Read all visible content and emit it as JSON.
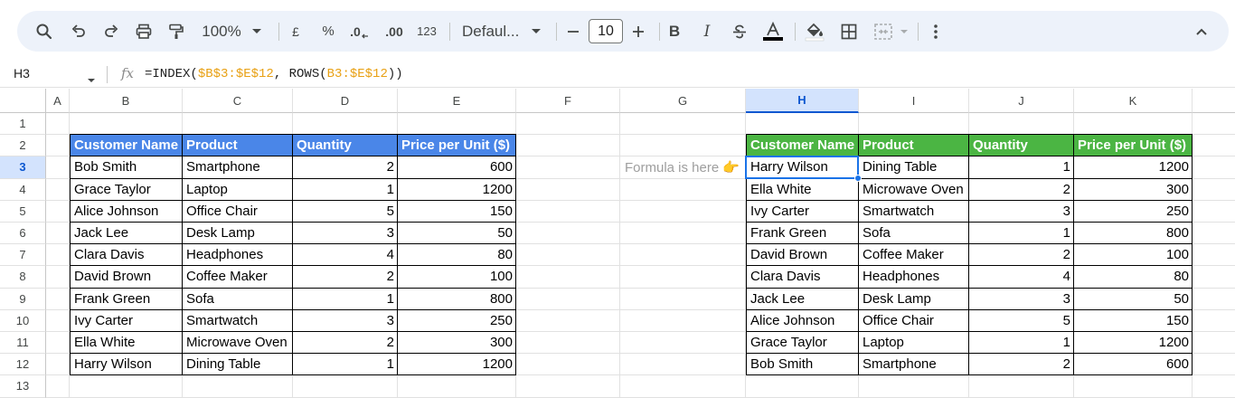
{
  "toolbar": {
    "zoom": "100%",
    "currency": "£",
    "percent": "%",
    "decrease_decimal": ".0",
    "increase_decimal": ".00",
    "number_format": "123",
    "font": "Defaul...",
    "font_size": "10",
    "bold": "B",
    "italic": "I",
    "icons": [
      "search-icon",
      "undo-icon",
      "redo-icon",
      "print-icon",
      "paint-format-icon",
      "zoom-dropdown-icon",
      "font-dropdown-icon",
      "minus-icon",
      "plus-icon",
      "strikethrough-icon",
      "text-color-icon",
      "fill-color-icon",
      "borders-icon",
      "merge-cells-icon",
      "more-options-icon",
      "collapse-icon"
    ],
    "text_color": "#000000",
    "accent": "#0b57d0"
  },
  "formula_bar": {
    "name_box": "H3",
    "fx": "fx",
    "formula_prefix": "=INDEX(",
    "ref1": "$B$3:$E$12",
    "formula_mid": ", ROWS(",
    "ref2": "B3:$E$12",
    "formula_suffix": "))"
  },
  "columns": [
    "A",
    "B",
    "C",
    "D",
    "E",
    "F",
    "G",
    "H",
    "I",
    "J",
    "K"
  ],
  "rows": [
    "1",
    "2",
    "3",
    "4",
    "5",
    "6",
    "7",
    "8",
    "9",
    "10",
    "11",
    "12",
    "13"
  ],
  "selected_cell": "H3",
  "left_table": {
    "header_color": "#4a86e8",
    "headers": [
      "Customer Name",
      "Product",
      "Quantity",
      "Price per Unit ($)"
    ],
    "rows": [
      [
        "Bob Smith",
        "Smartphone",
        "2",
        "600"
      ],
      [
        "Grace Taylor",
        "Laptop",
        "1",
        "1200"
      ],
      [
        "Alice Johnson",
        "Office Chair",
        "5",
        "150"
      ],
      [
        "Jack Lee",
        "Desk Lamp",
        "3",
        "50"
      ],
      [
        "Clara Davis",
        "Headphones",
        "4",
        "80"
      ],
      [
        "David Brown",
        "Coffee Maker",
        "2",
        "100"
      ],
      [
        "Frank Green",
        "Sofa",
        "1",
        "800"
      ],
      [
        "Ivy Carter",
        "Smartwatch",
        "3",
        "250"
      ],
      [
        "Ella White",
        "Microwave Oven",
        "2",
        "300"
      ],
      [
        "Harry Wilson",
        "Dining Table",
        "1",
        "1200"
      ]
    ]
  },
  "note": "Formula is here 👉",
  "right_table": {
    "header_color": "#4bb543",
    "headers": [
      "Customer Name",
      "Product",
      "Quantity",
      "Price per Unit ($)"
    ],
    "rows": [
      [
        "Harry Wilson",
        "Dining Table",
        "1",
        "1200"
      ],
      [
        "Ella White",
        "Microwave Oven",
        "2",
        "300"
      ],
      [
        "Ivy Carter",
        "Smartwatch",
        "3",
        "250"
      ],
      [
        "Frank Green",
        "Sofa",
        "1",
        "800"
      ],
      [
        "David Brown",
        "Coffee Maker",
        "2",
        "100"
      ],
      [
        "Clara Davis",
        "Headphones",
        "4",
        "80"
      ],
      [
        "Jack Lee",
        "Desk Lamp",
        "3",
        "50"
      ],
      [
        "Alice Johnson",
        "Office Chair",
        "5",
        "150"
      ],
      [
        "Grace Taylor",
        "Laptop",
        "1",
        "1200"
      ],
      [
        "Bob Smith",
        "Smartphone",
        "2",
        "600"
      ]
    ]
  }
}
